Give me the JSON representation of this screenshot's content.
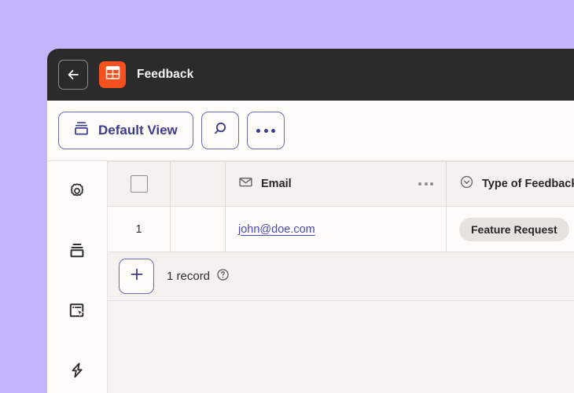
{
  "window": {
    "titlebar": {
      "back_icon": "arrow-left-icon",
      "app_icon": "table-grid-icon",
      "app_icon_color": "#f4511e",
      "title": "Feedback"
    },
    "toolbar": {
      "view_button_label": "Default View",
      "view_button_icon": "stacked-views-icon",
      "search_icon": "search-icon",
      "more_icon": "more-horizontal-icon",
      "accent_color": "#3c3c8c"
    },
    "sidebar": {
      "items": [
        {
          "name": "settings",
          "icon": "gear-icon"
        },
        {
          "name": "views",
          "icon": "stacked-views-icon"
        },
        {
          "name": "interfaces",
          "icon": "interface-cursor-icon"
        },
        {
          "name": "automations",
          "icon": "lightning-bolt-icon"
        }
      ]
    },
    "grid": {
      "columns": [
        {
          "key": "check",
          "label": "",
          "icon": "checkbox-icon"
        },
        {
          "key": "blank",
          "label": "",
          "icon": ""
        },
        {
          "key": "email",
          "label": "Email",
          "icon": "envelope-icon",
          "menu_icon": "more-horizontal-icon"
        },
        {
          "key": "type",
          "label": "Type of Feedback",
          "icon": "chevron-down-circle-icon"
        }
      ],
      "rows": [
        {
          "number": "1",
          "email": "john@doe.com",
          "type": "Feature Request"
        }
      ]
    },
    "footer": {
      "add_icon": "plus-icon",
      "record_count": "1 record",
      "help_icon": "help-circle-icon"
    }
  }
}
